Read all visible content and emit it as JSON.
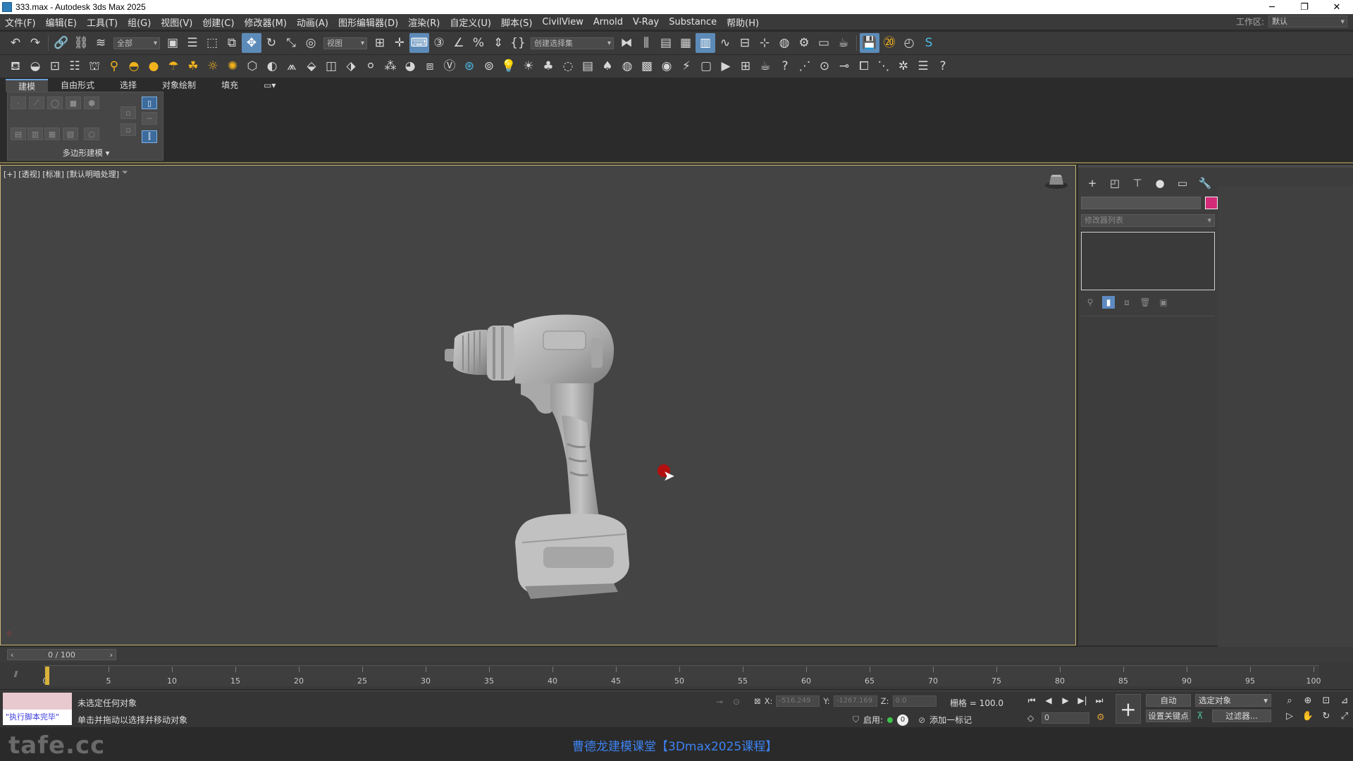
{
  "window": {
    "title": "333.max - Autodesk 3ds Max 2025",
    "buttons": [
      "─",
      "❐",
      "✕"
    ]
  },
  "menu": {
    "items": [
      "文件(F)",
      "编辑(E)",
      "工具(T)",
      "组(G)",
      "视图(V)",
      "创建(C)",
      "修改器(M)",
      "动画(A)",
      "图形编辑器(D)",
      "渲染(R)",
      "自定义(U)",
      "脚本(S)",
      "CivilView",
      "Arnold",
      "V-Ray",
      "Substance",
      "帮助(H)"
    ],
    "workspace_label": "工作区:",
    "workspace_value": "默认"
  },
  "toolbar": {
    "selection_filter": "全部",
    "ref_coord": "视图",
    "named_selection": "创建选择集"
  },
  "ribbon": {
    "tabs": [
      "建模",
      "自由形式",
      "选择",
      "对象绘制",
      "填充"
    ],
    "panel_label": "多边形建模 ▾"
  },
  "viewport": {
    "label": "[+] [透视] [标准] [默认明暗处理]",
    "filter_icon": "funnel-icon"
  },
  "command_panel": {
    "modifier_list": "修改器列表",
    "swatch_color": "#d42b78"
  },
  "timeline": {
    "frame_slider": "0 / 100",
    "ticks": [
      "0",
      "5",
      "10",
      "15",
      "20",
      "25",
      "30",
      "35",
      "40",
      "45",
      "50",
      "55",
      "60",
      "65",
      "70",
      "75",
      "80",
      "85",
      "90",
      "95",
      "100"
    ]
  },
  "status": {
    "maxscript_text": "\"执行脚本完毕\"",
    "message1": "未选定任何对象",
    "message2": "单击并拖动以选择并移动对象",
    "x_label": "X:",
    "x_value": "-516.249",
    "y_label": "Y:",
    "y_value": "-1267.169",
    "z_label": "Z:",
    "z_value": "0.0",
    "grid": "栅格 = 100.0",
    "enable_label": "启用:",
    "add_time_tag": "添加一标记",
    "frame_value": "0",
    "auto_key": "自动",
    "set_key": "设置关键点",
    "selected_objects": "选定对象",
    "filters": "过滤器..."
  },
  "footer": {
    "watermark": "tafe.cc",
    "course_title": "曹德龙建模课堂【3Dmax2025课程】"
  }
}
